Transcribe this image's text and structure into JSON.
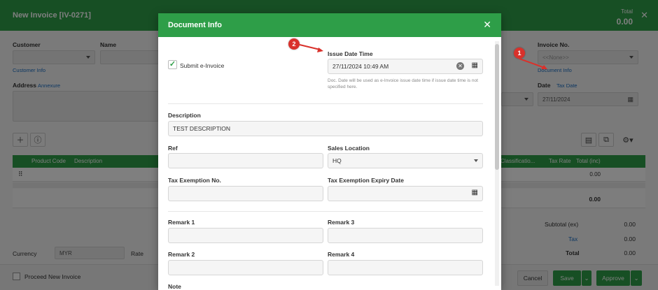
{
  "background": {
    "title": "New Invoice [IV-0271]",
    "total_label": "Total",
    "total_value": "0.00",
    "customer_label": "Customer",
    "name_label": "Name",
    "customer_info_link": "Customer Info",
    "address_label": "Address",
    "annexure_link": "Annexure",
    "invoice_no_label": "Invoice No.",
    "invoice_no_placeholder": "<<None>>",
    "document_info_link": "Document Info",
    "date_label": "Date",
    "tax_date_link": "Tax Date",
    "date_value": "27/11/2024",
    "grid_columns": [
      "Product Code",
      "Description",
      "Classificatio...",
      "Tax Rate",
      "Total (inc)"
    ],
    "grid_row_value": "0.00",
    "grid_total_value": "0.00",
    "subtotal_label": "Subtotal (ex)",
    "subtotal_value": "0.00",
    "tax_label": "Tax",
    "tax_value": "0.00",
    "total2_label": "Total",
    "total2_value": "0.00",
    "currency_label": "Currency",
    "currency_value": "MYR",
    "rate_label": "Rate",
    "proceed_label": "Proceed New Invoice",
    "cancel_label": "Cancel",
    "save_label": "Save",
    "approve_label": "Approve"
  },
  "modal": {
    "title": "Document Info",
    "submit_einvoice_label": "Submit e-Invoice",
    "submit_einvoice_checked": true,
    "issue_date_label": "Issue Date Time",
    "issue_date_value": "27/11/2024 10:49 AM",
    "issue_date_help": "Doc. Date will be used as e-Invoice issue date time if issue date time is not specified here.",
    "description_label": "Description",
    "description_value": "TEST DESCRIPTION",
    "ref_label": "Ref",
    "sales_location_label": "Sales Location",
    "sales_location_value": "HQ",
    "tax_exemption_no_label": "Tax Exemption No.",
    "tax_exemption_expiry_label": "Tax Exemption Expiry Date",
    "remark1_label": "Remark 1",
    "remark3_label": "Remark 3",
    "remark2_label": "Remark 2",
    "remark4_label": "Remark 4",
    "note_label": "Note"
  },
  "annotations": {
    "badge1": "1",
    "badge2": "2"
  },
  "colors": {
    "accent": "#2e9e48",
    "annotation": "#d9312b",
    "link": "#1a6fc4"
  }
}
